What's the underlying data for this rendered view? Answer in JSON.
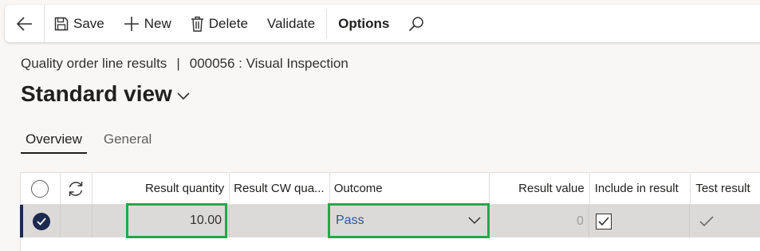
{
  "toolbar": {
    "save_label": "Save",
    "new_label": "New",
    "delete_label": "Delete",
    "validate_label": "Validate",
    "options_label": "Options"
  },
  "header": {
    "breadcrumb_form": "Quality order line results",
    "breadcrumb_separator": "|",
    "breadcrumb_record": "000056 : Visual Inspection",
    "view_title": "Standard view"
  },
  "tabs": [
    {
      "label": "Overview",
      "active": true
    },
    {
      "label": "General",
      "active": false
    }
  ],
  "grid": {
    "columns": [
      "Result quantity",
      "Result CW qua...",
      "Outcome",
      "Result value",
      "Include in result",
      "Test result"
    ],
    "rows": [
      {
        "selected": true,
        "result_quantity": "10.00",
        "result_cw_quantity": "",
        "outcome": "Pass",
        "result_value": "0",
        "include_in_result": true,
        "test_result": "checkmark"
      }
    ]
  },
  "icons": [
    "back-arrow-icon",
    "save-icon",
    "plus-icon",
    "trash-icon",
    "search-icon",
    "chevron-down-icon",
    "refresh-icon",
    "checkmark-icon"
  ],
  "colors": {
    "highlight": "#1faa4a",
    "selected_accent": "#1b2a4e",
    "link_text": "#2b5797",
    "row_selected_bg": "#dcdad8"
  }
}
